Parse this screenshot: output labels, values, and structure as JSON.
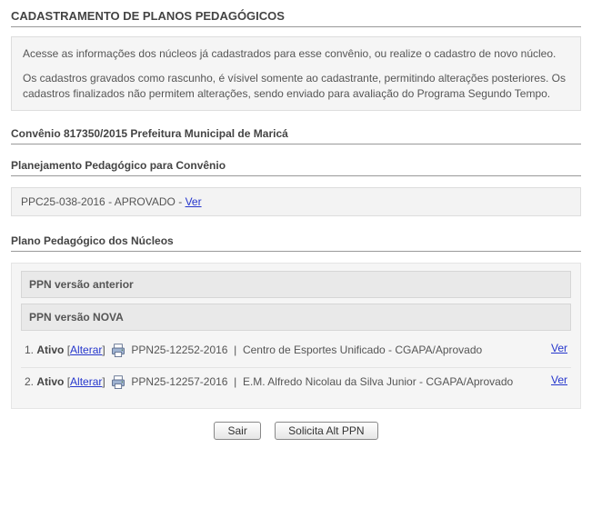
{
  "page_title": "CADASTRAMENTO DE PLANOS PEDAGÓGICOS",
  "intro": {
    "p1": "Acesse as informações dos núcleos já cadastrados para esse convênio, ou realize o cadastro de novo núcleo.",
    "p2": "Os cadastros gravados como rascunho, é vísivel somente ao cadastrante, permitindo alterações posteriores. Os cadastros finalizados não permitem alterações, sendo enviado para avaliação do Programa Segundo Tempo."
  },
  "convenio_title": "Convênio 817350/2015 Prefeitura Municipal de Maricá",
  "ppc": {
    "section_title": "Planejamento Pedagógico para Convênio",
    "code": "PPC25-038-2016",
    "status": "APROVADO",
    "ver_label": "Ver"
  },
  "nucleos": {
    "section_title": "Plano Pedagógico dos Núcleos",
    "ver_anterior_label": "PPN versão anterior",
    "ver_nova_label": "PPN versão NOVA",
    "alterar_label": "Alterar",
    "ver_label": "Ver",
    "items": [
      {
        "idx": "1.",
        "status": "Ativo",
        "code": "PPN25-12252-2016",
        "desc": "Centro de Esportes Unificado - CGAPA/Aprovado"
      },
      {
        "idx": "2.",
        "status": "Ativo",
        "code": "PPN25-12257-2016",
        "desc": "E.M. Alfredo Nicolau da Silva Junior - CGAPA/Aprovado"
      }
    ]
  },
  "buttons": {
    "sair": "Sair",
    "solicita": "Solicita Alt PPN"
  }
}
